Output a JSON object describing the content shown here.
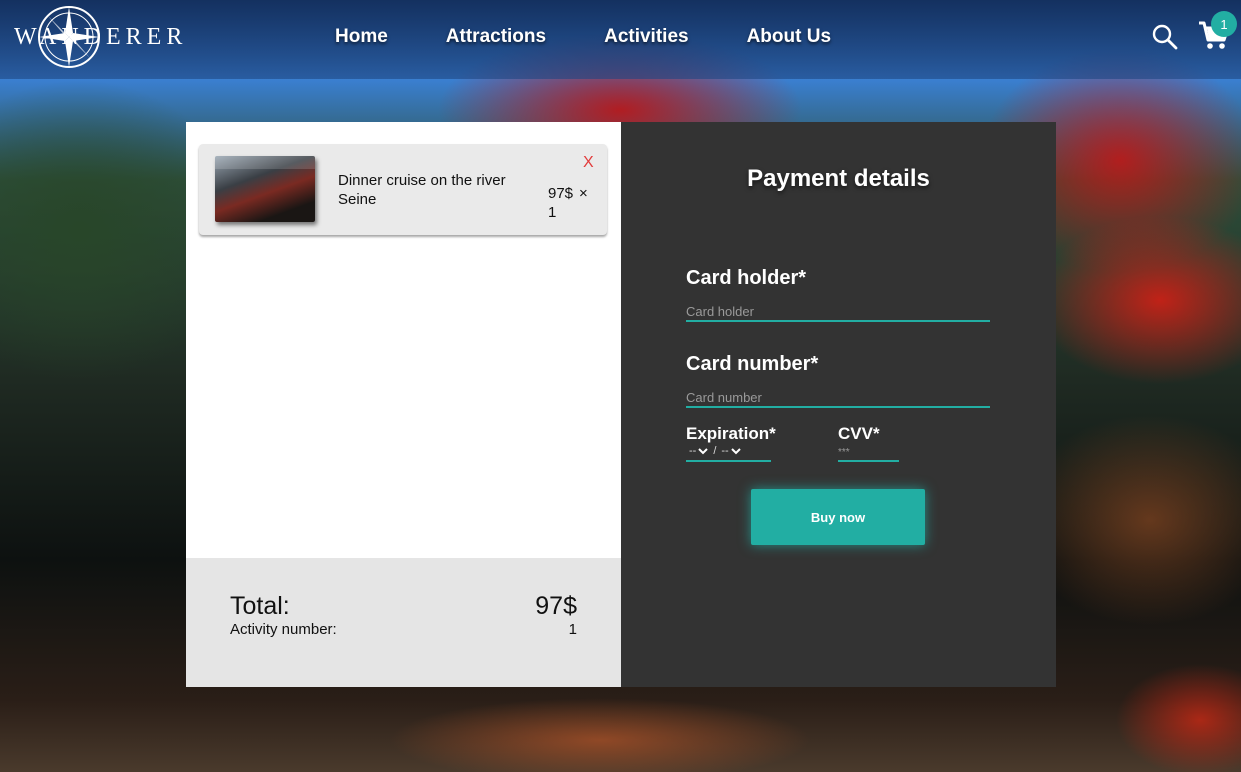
{
  "nav": {
    "logo": "WANDERER",
    "links": [
      "Home",
      "Attractions",
      "Activities",
      "About Us"
    ],
    "cart_count": "1"
  },
  "cart": {
    "items": [
      {
        "name": "Dinner cruise on the river Seine",
        "price": "97$",
        "times": "×",
        "qty": "1",
        "remove": "X"
      }
    ],
    "total_label": "Total:",
    "total_value": "97$",
    "count_label": "Activity number:",
    "count_value": "1"
  },
  "payment": {
    "title": "Payment details",
    "card_holder_label": "Card holder*",
    "card_holder_placeholder": "Card holder",
    "card_number_label": "Card number*",
    "card_number_placeholder": "Card number",
    "expiration_label": "Expiration*",
    "expiration_month": "--",
    "expiration_sep": "/",
    "expiration_year": "--",
    "cvv_label": "CVV*",
    "cvv_placeholder": "***",
    "buy_label": "Buy now"
  },
  "colors": {
    "accent": "#22aea3",
    "remove": "#e23b3b",
    "panel_dark": "#333333"
  }
}
